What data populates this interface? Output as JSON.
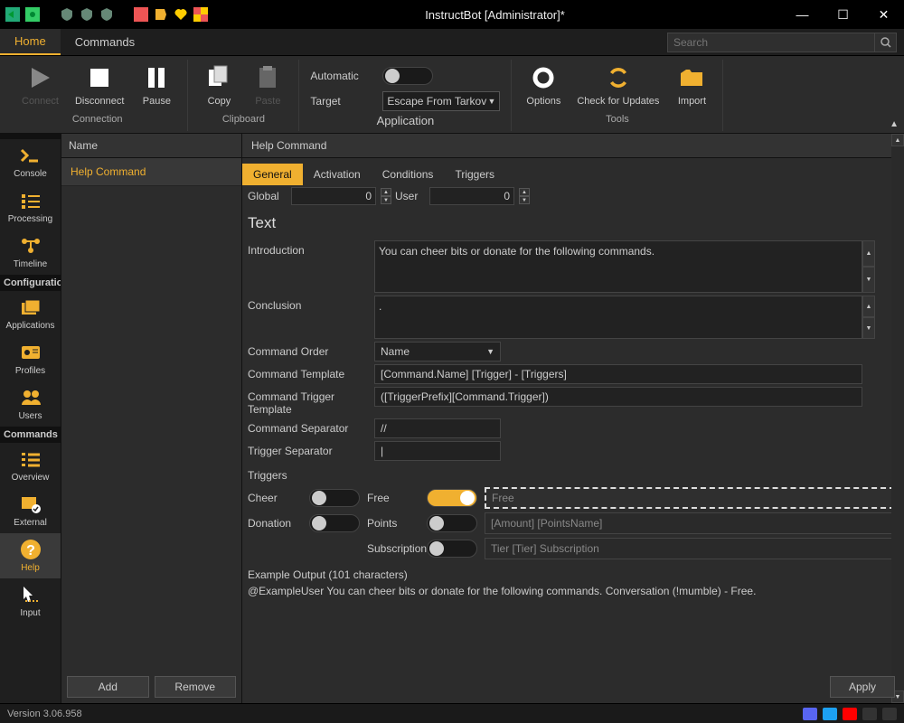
{
  "window": {
    "title": "InstructBot [Administrator]*"
  },
  "menubar": {
    "tabs": [
      "Home",
      "Commands"
    ],
    "active": 0,
    "search_placeholder": "Search"
  },
  "ribbon": {
    "connection": {
      "label": "Connection",
      "connect": "Connect",
      "disconnect": "Disconnect",
      "pause": "Pause"
    },
    "clipboard": {
      "label": "Clipboard",
      "copy": "Copy",
      "paste": "Paste"
    },
    "application": {
      "label": "Application",
      "automatic": "Automatic",
      "target": "Target",
      "target_value": "Escape From Tarkov"
    },
    "tools": {
      "label": "Tools",
      "options": "Options",
      "check": "Check for Updates",
      "import": "Import"
    }
  },
  "leftnav": {
    "groups": [
      {
        "header": "",
        "items": [
          {
            "label": "Console"
          },
          {
            "label": "Processing"
          },
          {
            "label": "Timeline"
          }
        ]
      },
      {
        "header": "Configuration",
        "items": [
          {
            "label": "Applications"
          },
          {
            "label": "Profiles"
          },
          {
            "label": "Users"
          }
        ]
      },
      {
        "header": "Commands",
        "items": [
          {
            "label": "Overview"
          },
          {
            "label": "External"
          },
          {
            "label": "Help",
            "active": true
          },
          {
            "label": "Input"
          }
        ]
      }
    ]
  },
  "cmdlist": {
    "header": "Name",
    "items": [
      {
        "label": "Help Command",
        "selected": true
      }
    ],
    "add": "Add",
    "remove": "Remove"
  },
  "editor": {
    "header": "Help Command",
    "tabs": [
      "General",
      "Activation",
      "Conditions",
      "Triggers"
    ],
    "active_tab": 0,
    "global_label": "Global",
    "global_value": "0",
    "user_label": "User",
    "user_value": "0",
    "section_text": "Text",
    "introduction_label": "Introduction",
    "introduction_value": "You can cheer bits or donate for the following commands.",
    "conclusion_label": "Conclusion",
    "conclusion_value": ".",
    "command_order_label": "Command Order",
    "command_order_value": "Name",
    "command_template_label": "Command Template",
    "command_template_value": "[Command.Name] [Trigger] - [Triggers]",
    "command_trigger_tmpl_label": "Command Trigger Template",
    "command_trigger_tmpl_value": "([TriggerPrefix][Command.Trigger])",
    "command_separator_label": "Command Separator",
    "command_separator_value": "//",
    "trigger_separator_label": "Trigger Separator",
    "trigger_separator_value": "|",
    "triggers_header": "Triggers",
    "cheer_label": "Cheer",
    "free_label": "Free",
    "free_placeholder": "Free",
    "donation_label": "Donation",
    "points_label": "Points",
    "points_placeholder": "[Amount] [PointsName]",
    "subscription_label": "Subscription",
    "subscription_placeholder": "Tier [Tier] Subscription",
    "example_label": "Example Output (101 characters)",
    "example_text": "@ExampleUser You can cheer bits or donate for the following commands. Conversation  (!mumble) - Free.",
    "apply": "Apply"
  },
  "status": {
    "version": "Version 3.06.958"
  },
  "colors": {
    "accent": "#f0b030"
  }
}
